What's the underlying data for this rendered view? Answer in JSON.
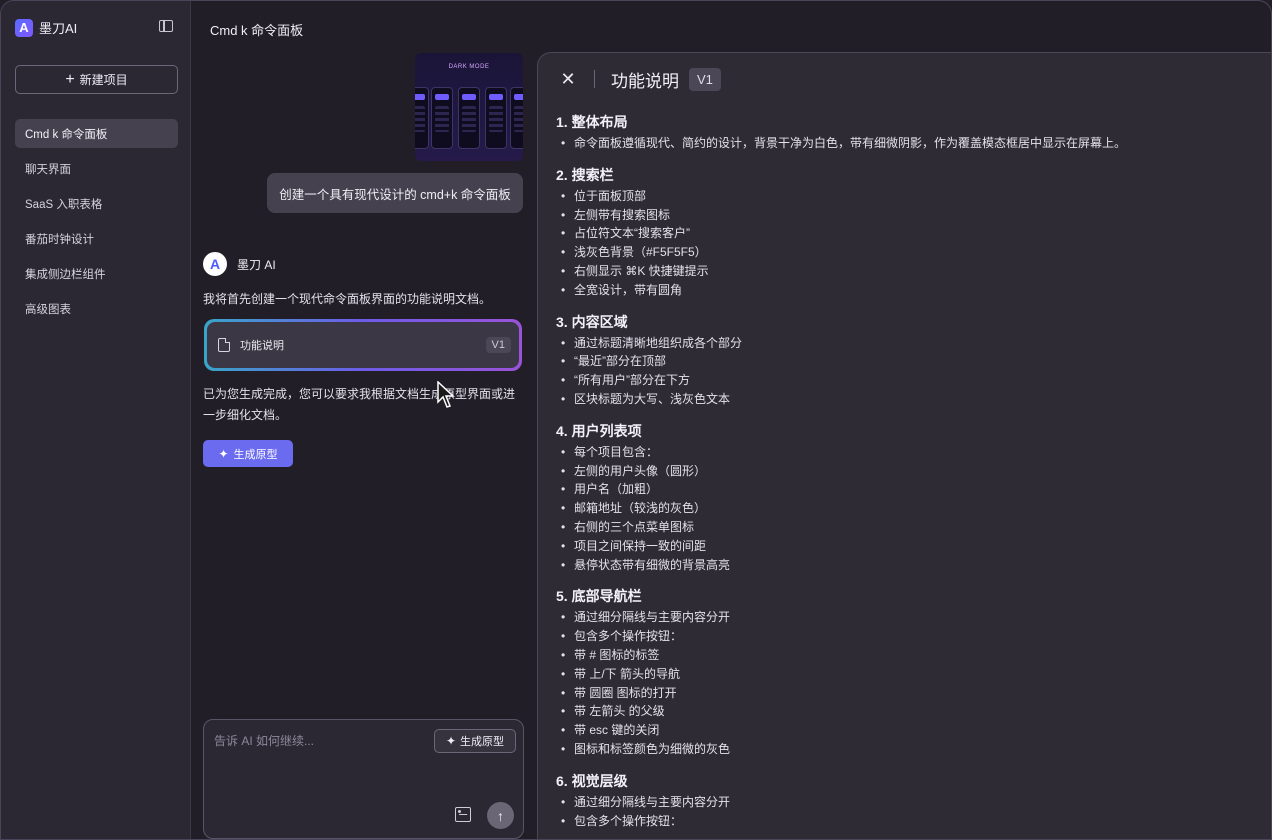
{
  "sidebar": {
    "brand": "墨刀AI",
    "new_button": "新建项目",
    "items": [
      {
        "label": "Cmd k 命令面板"
      },
      {
        "label": "聊天界面"
      },
      {
        "label": "SaaS 入职表格"
      },
      {
        "label": "番茄时钟设计"
      },
      {
        "label": "集成侧边栏组件"
      },
      {
        "label": "高级图表"
      }
    ]
  },
  "chat": {
    "title": "Cmd k 命令面板",
    "thumbnail_caption": "DARK MODE",
    "user_message": "创建一个具有现代设计的 cmd+k 命令面板",
    "ai_name": "墨刀 AI",
    "ai_intro": "我将首先创建一个现代命令面板界面的功能说明文档。",
    "doc_card": {
      "label": "功能说明",
      "version": "V1"
    },
    "ai_followup": "已为您生成完成，您可以要求我根据文档生成原型界面或进一步细化文档。",
    "generate_button": "生成原型",
    "composer": {
      "placeholder": "告诉 AI 如何继续...",
      "generate_button": "生成原型"
    }
  },
  "panel": {
    "title": "功能说明",
    "version": "V1",
    "sections": [
      {
        "heading": "1. 整体布局",
        "items": [
          "命令面板遵循现代、简约的设计，背景干净为白色，带有细微阴影，作为覆盖模态框居中显示在屏幕上。"
        ]
      },
      {
        "heading": "2. 搜索栏",
        "items": [
          "位于面板顶部",
          "左侧带有搜索图标",
          "占位符文本“搜索客户”",
          "浅灰色背景（#F5F5F5）",
          "右侧显示 ⌘K 快捷键提示",
          "全宽设计，带有圆角"
        ]
      },
      {
        "heading": "3. 内容区域",
        "items": [
          "通过标题清晰地组织成各个部分",
          "“最近”部分在顶部",
          "“所有用户”部分在下方",
          "区块标题为大写、浅灰色文本"
        ]
      },
      {
        "heading": "4. 用户列表项",
        "items": [
          "每个项目包含：",
          "左侧的用户头像（圆形）",
          "用户名（加粗）",
          "邮箱地址（较浅的灰色）",
          "右侧的三个点菜单图标",
          "项目之间保持一致的间距",
          "悬停状态带有细微的背景高亮"
        ]
      },
      {
        "heading": "5. 底部导航栏",
        "items": [
          "通过细分隔线与主要内容分开",
          "包含多个操作按钮：",
          "带 # 图标的标签",
          "带 上/下 箭头的导航",
          "带 圆圈 图标的打开",
          "带 左箭头 的父级",
          "带 esc 键的关闭",
          "图标和标签颜色为细微的灰色"
        ]
      },
      {
        "heading": "6. 视觉层级",
        "items": [
          "通过细分隔线与主要内容分开",
          "包含多个操作按钮："
        ]
      }
    ]
  }
}
